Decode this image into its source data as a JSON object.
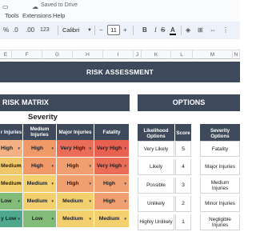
{
  "menubar": {
    "saved_label": "Saved to Drive",
    "menus": [
      "Tools",
      "Extensions",
      "Help"
    ]
  },
  "toolbar": {
    "percent": "%",
    "decimal_decrease": ".0",
    "decimal_increase": ".00",
    "number_format": "123",
    "font": "Calibri",
    "minus": "−",
    "font_size": "11",
    "plus": "+",
    "bold": "B",
    "italic": "I",
    "strikethrough": "S",
    "text_color": "A"
  },
  "columns": [
    "E",
    "F",
    "G",
    "H",
    "I",
    "J",
    "K",
    "L",
    "M",
    "N"
  ],
  "banner": {
    "title": "RISK ASSESSMENT"
  },
  "risk_matrix": {
    "title": "RISK MATRIX",
    "axis_label": "Severity",
    "headers": [
      "r Injuries",
      "Medium\nInjuries",
      "Major Injuries",
      "Fatality"
    ],
    "rows": [
      [
        "High",
        "High",
        "Very High",
        "Very High"
      ],
      [
        "Medium",
        "High",
        "High",
        "Very High"
      ],
      [
        "Medium",
        "Medium",
        "High",
        "High"
      ],
      [
        "Low",
        "Medium",
        "Medium",
        "High"
      ],
      [
        "y Low",
        "Low",
        "Medium",
        "Medium"
      ]
    ],
    "colors": [
      [
        "#f4b183",
        "#f09a6a",
        "#ea6d57",
        "#e8604f"
      ],
      [
        "#f1c76c",
        "#f09a6a",
        "#f0a070",
        "#ea6d57"
      ],
      [
        "#f3cf6e",
        "#f3cf6e",
        "#f0a070",
        "#f0a070"
      ],
      [
        "#83bc79",
        "#f3cf6e",
        "#f3cf6e",
        "#f0a070"
      ],
      [
        "#4ea98c",
        "#83bc79",
        "#f3cf6e",
        "#f3cf6e"
      ]
    ]
  },
  "options": {
    "title": "OPTIONS",
    "likelihood_header": "Likelihood\nOptions",
    "score_header": "Score",
    "severity_header": "Severity\nOptions",
    "likelihood": [
      {
        "label": "Very Likely",
        "score": "5"
      },
      {
        "label": "Likely",
        "score": "4"
      },
      {
        "label": "Possible",
        "score": "3"
      },
      {
        "label": "Unlikely",
        "score": "2"
      },
      {
        "label": "Highly Unlikely",
        "score": "1"
      }
    ],
    "severity": [
      "Fatality",
      "Major Injuries",
      "Medium\nInjuries",
      "Minor Injuries",
      "Negligible\nInjuries"
    ]
  }
}
